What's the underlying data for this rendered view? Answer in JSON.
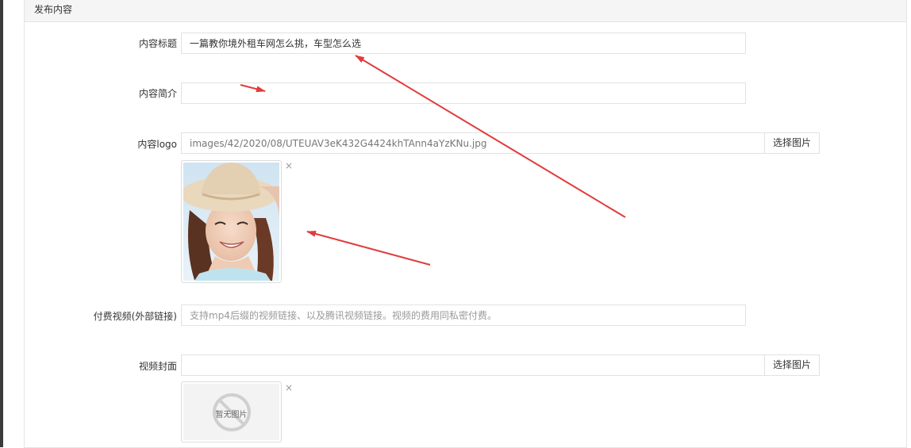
{
  "panel": {
    "title": "发布内容"
  },
  "form": {
    "content_title": {
      "label": "内容标题",
      "value": "一篇教你境外租车网怎么挑，车型怎么选"
    },
    "content_summary": {
      "label": "内容简介",
      "value": ""
    },
    "content_logo": {
      "label": "内容logo",
      "value": "images/42/2020/08/UTEUAV3eK432G4424khTAnn4aYzKNu.jpg",
      "button": "选择图片"
    },
    "paid_video": {
      "label": "付费视频(外部链接)",
      "placeholder": "支持mp4后缀的视频链接、以及腾讯视频链接。视频的费用同私密付费。"
    },
    "video_cover": {
      "label": "视频封面",
      "value": "",
      "button": "选择图片",
      "empty_text": "暂无图片"
    },
    "remove_symbol": "×"
  },
  "colors": {
    "arrow": "#e23c3c",
    "panel_head": "#f5f5f5",
    "border": "#e2e2e2"
  },
  "icons": {
    "remove": "close-icon",
    "no_image": "no-image-icon",
    "annotation": "red-arrow"
  }
}
